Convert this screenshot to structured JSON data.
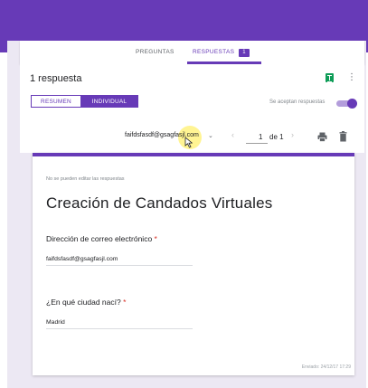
{
  "tabs": {
    "preguntas": "PREGUNTAS",
    "respuestas": "RESPUESTAS",
    "respuestas_count": "1"
  },
  "summary": {
    "title": "1 respuesta",
    "view_resumen": "RESUMEN",
    "view_individual": "INDIVIDUAL",
    "accepting_label": "Se aceptan respuestas",
    "accepting_on": true
  },
  "navigator": {
    "email": "faifdsfasdf@gsagfasjl.com",
    "prev": "‹",
    "page_number": "1",
    "page_of": "de 1",
    "next": "›"
  },
  "response": {
    "no_edit_note": "No se pueden editar las respuestas",
    "form_title": "Creación de Candados Virtuales",
    "questions": [
      {
        "label": "Dirección de correo electrónico",
        "required_mark": "*",
        "answer": "faifdsfasdf@gsagfasjl.com"
      },
      {
        "label": "¿En qué ciudad nací?",
        "required_mark": "*",
        "answer": "Madrid"
      }
    ],
    "sent": "Enviado: 24/12/17 17:29"
  },
  "colors": {
    "accent": "#673ab7",
    "sheets": "#0f9d58",
    "required": "#d93025"
  },
  "icons": [
    "sheets-icon",
    "more-vert-icon",
    "chevron-down-icon",
    "chevron-left-icon",
    "chevron-right-icon",
    "print-icon",
    "trash-icon",
    "cursor-icon"
  ]
}
